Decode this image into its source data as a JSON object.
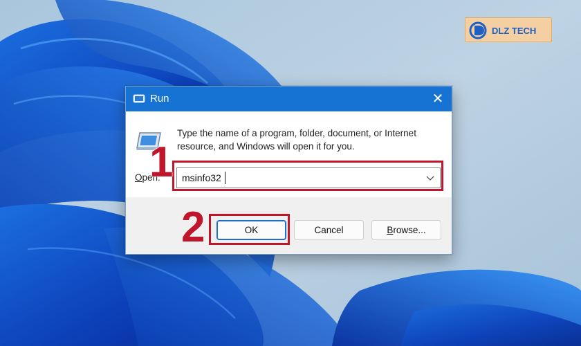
{
  "dialog": {
    "title": "Run",
    "description_line1": "Type the name of a program, folder, document, or Internet",
    "description_line2": "resource, and Windows will open it for you.",
    "open_label_mnemonic": "O",
    "open_label_rest": "pen:",
    "open_value": "msinfo32",
    "buttons": {
      "ok": "OK",
      "cancel": "Cancel",
      "browse_mnemonic": "B",
      "browse_rest": "rowse..."
    },
    "icons": [
      "run-icon",
      "close-icon",
      "chevron-down-icon"
    ]
  },
  "annotations": {
    "step1": "1",
    "step2": "2",
    "color": "#c0162b"
  },
  "logo": {
    "text": "DLZ TECH"
  },
  "colors": {
    "titlebar": "#1673d3",
    "ok_border": "#1d6fd0",
    "annotation": "#c0162b"
  }
}
